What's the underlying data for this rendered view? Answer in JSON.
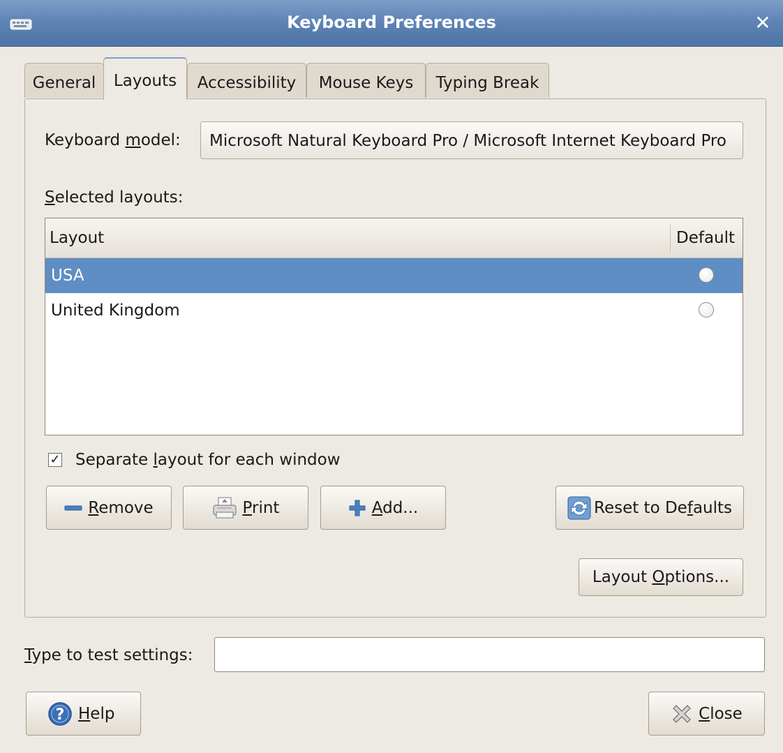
{
  "window": {
    "title": "Keyboard Preferences",
    "close_glyph": "✕"
  },
  "tabs": [
    {
      "label": "General",
      "active": false
    },
    {
      "label": "Layouts",
      "active": true
    },
    {
      "label": "Accessibility",
      "active": false
    },
    {
      "label": "Mouse Keys",
      "active": false
    },
    {
      "label": "Typing Break",
      "active": false
    }
  ],
  "layouts": {
    "model_label_pre": "Keyboard ",
    "model_label_mnemonic": "m",
    "model_label_post": "odel:",
    "model_value": "Microsoft Natural Keyboard Pro / Microsoft Internet Keyboard Pro",
    "selected_label_mnemonic": "S",
    "selected_label_post": "elected layouts:",
    "columns": {
      "layout": "Layout",
      "default": "Default"
    },
    "rows": [
      {
        "name": "USA",
        "selected": true,
        "default": false
      },
      {
        "name": "United Kingdom",
        "selected": false,
        "default": false
      }
    ],
    "separate": {
      "checked": true,
      "check_glyph": "✓",
      "pre": "Separate ",
      "mnemonic": "l",
      "post": "ayout for each window"
    },
    "buttons": {
      "remove": {
        "mnemonic": "R",
        "rest": "emove",
        "icon": "minus-icon"
      },
      "print": {
        "mnemonic": "P",
        "rest": "rint",
        "icon": "printer-icon"
      },
      "add": {
        "mnemonic": "A",
        "rest": "dd...",
        "icon": "plus-icon"
      },
      "reset": {
        "pre": "Reset to De",
        "mnemonic": "f",
        "post": "aults",
        "icon": "refresh-icon"
      },
      "options": {
        "pre": "Layout ",
        "mnemonic": "O",
        "post": "ptions..."
      }
    }
  },
  "test": {
    "label_mnemonic": "T",
    "label_post": "ype to test settings:",
    "value": ""
  },
  "footer": {
    "help": {
      "mnemonic": "H",
      "rest": "elp",
      "icon": "help-icon"
    },
    "close": {
      "mnemonic": "C",
      "rest": "lose",
      "icon": "close-icon"
    }
  },
  "colors": {
    "titlebar": "#5f85b6",
    "selection": "#5f8ec4",
    "window_bg": "#ede9e3"
  }
}
